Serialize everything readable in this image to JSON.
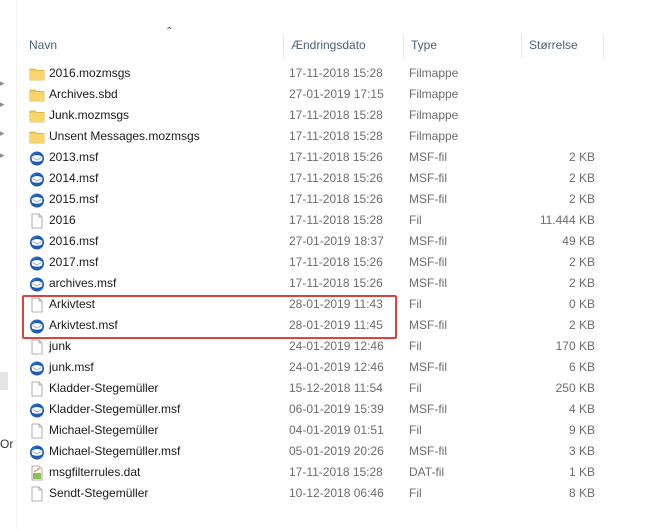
{
  "header": {
    "name": "Navn",
    "date": "Ændringsdato",
    "type": "Type",
    "size": "Størrelse"
  },
  "left_pane": {
    "cut_text": "Or"
  },
  "files": [
    {
      "name": "2016.mozmsgs",
      "date": "17-11-2018 15:28",
      "type": "Filmappe",
      "size": "",
      "icon": "folder-icon"
    },
    {
      "name": "Archives.sbd",
      "date": "27-01-2019 17:15",
      "type": "Filmappe",
      "size": "",
      "icon": "folder-icon"
    },
    {
      "name": "Junk.mozmsgs",
      "date": "17-11-2018 15:28",
      "type": "Filmappe",
      "size": "",
      "icon": "folder-icon"
    },
    {
      "name": "Unsent Messages.mozmsgs",
      "date": "17-11-2018 15:28",
      "type": "Filmappe",
      "size": "",
      "icon": "folder-icon"
    },
    {
      "name": "2013.msf",
      "date": "17-11-2018 15:26",
      "type": "MSF-fil",
      "size": "2 KB",
      "icon": "thunderbird-icon"
    },
    {
      "name": "2014.msf",
      "date": "17-11-2018 15:26",
      "type": "MSF-fil",
      "size": "2 KB",
      "icon": "thunderbird-icon"
    },
    {
      "name": "2015.msf",
      "date": "17-11-2018 15:26",
      "type": "MSF-fil",
      "size": "2 KB",
      "icon": "thunderbird-icon"
    },
    {
      "name": "2016",
      "date": "17-11-2018 15:28",
      "type": "Fil",
      "size": "11.444 KB",
      "icon": "file-icon"
    },
    {
      "name": "2016.msf",
      "date": "27-01-2019 18:37",
      "type": "MSF-fil",
      "size": "49 KB",
      "icon": "thunderbird-icon"
    },
    {
      "name": "2017.msf",
      "date": "17-11-2018 15:26",
      "type": "MSF-fil",
      "size": "2 KB",
      "icon": "thunderbird-icon"
    },
    {
      "name": "archives.msf",
      "date": "17-11-2018 15:26",
      "type": "MSF-fil",
      "size": "2 KB",
      "icon": "thunderbird-icon"
    },
    {
      "name": "Arkivtest",
      "date": "28-01-2019 11:43",
      "type": "Fil",
      "size": "0 KB",
      "icon": "file-icon"
    },
    {
      "name": "Arkivtest.msf",
      "date": "28-01-2019 11:45",
      "type": "MSF-fil",
      "size": "2 KB",
      "icon": "thunderbird-icon"
    },
    {
      "name": "junk",
      "date": "24-01-2019 12:46",
      "type": "Fil",
      "size": "170 KB",
      "icon": "file-icon"
    },
    {
      "name": "junk.msf",
      "date": "24-01-2019 12:46",
      "type": "MSF-fil",
      "size": "6 KB",
      "icon": "thunderbird-icon"
    },
    {
      "name": "Kladder-Stegemüller",
      "date": "15-12-2018 11:54",
      "type": "Fil",
      "size": "250 KB",
      "icon": "file-icon"
    },
    {
      "name": "Kladder-Stegemüller.msf",
      "date": "06-01-2019 15:39",
      "type": "MSF-fil",
      "size": "4 KB",
      "icon": "thunderbird-icon"
    },
    {
      "name": "Michael-Stegemüller",
      "date": "04-01-2019 01:51",
      "type": "Fil",
      "size": "9 KB",
      "icon": "file-icon"
    },
    {
      "name": "Michael-Stegemüller.msf",
      "date": "05-01-2019 20:26",
      "type": "MSF-fil",
      "size": "3 KB",
      "icon": "thunderbird-icon"
    },
    {
      "name": "msgfilterrules.dat",
      "date": "17-11-2018 15:28",
      "type": "DAT-fil",
      "size": "1 KB",
      "icon": "dat-file-icon"
    },
    {
      "name": "Sendt-Stegemüller",
      "date": "10-12-2018 06:46",
      "type": "Fil",
      "size": "8 KB",
      "icon": "file-icon"
    }
  ],
  "colors": {
    "header_text": "#4c607a",
    "folder": "#f4c94f",
    "thunderbird": "#1e5bb3",
    "highlight_border": "#d9443d"
  }
}
